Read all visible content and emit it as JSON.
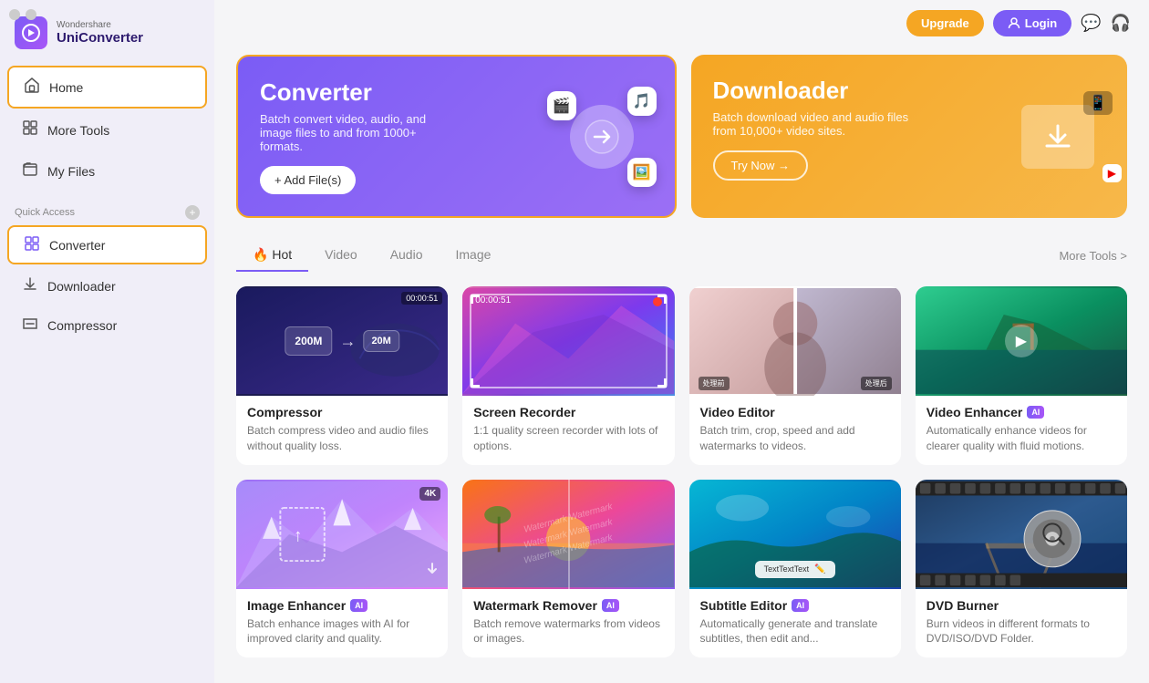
{
  "app": {
    "brand": "Wondershare",
    "name": "UniConverter",
    "traffic_light_close": "●",
    "traffic_light_min": "●"
  },
  "topbar": {
    "upgrade_label": "Upgrade",
    "login_label": "Login"
  },
  "sidebar": {
    "home_label": "Home",
    "more_tools_label": "More Tools",
    "my_files_label": "My Files",
    "quick_access_label": "Quick Access",
    "quick_items": [
      {
        "id": "converter",
        "label": "Converter",
        "active": true
      },
      {
        "id": "downloader",
        "label": "Downloader"
      },
      {
        "id": "compressor",
        "label": "Compressor"
      }
    ]
  },
  "hero": {
    "converter": {
      "title": "Converter",
      "subtitle": "Batch convert video, audio, and image files to and from 1000+ formats.",
      "btn_label": "+ Add File(s)"
    },
    "downloader": {
      "title": "Downloader",
      "subtitle": "Batch download video and audio files from 10,000+ video sites.",
      "btn_label": "Try Now →"
    }
  },
  "tabs": {
    "items": [
      {
        "id": "hot",
        "label": "Hot",
        "active": true,
        "fire": true
      },
      {
        "id": "video",
        "label": "Video"
      },
      {
        "id": "audio",
        "label": "Audio"
      },
      {
        "id": "image",
        "label": "Image"
      }
    ],
    "more_tools": "More Tools >"
  },
  "tools": [
    {
      "id": "compressor",
      "title": "Compressor",
      "desc": "Batch compress video and audio files without quality loss.",
      "ai": false,
      "compress_from": "200M",
      "compress_to": "20M"
    },
    {
      "id": "screen-recorder",
      "title": "Screen Recorder",
      "desc": "1:1 quality screen recorder with lots of options.",
      "ai": false
    },
    {
      "id": "video-editor",
      "title": "Video Editor",
      "desc": "Batch trim, crop, speed and add watermarks to videos.",
      "ai": false,
      "before_label": "处理前",
      "after_label": "处理后"
    },
    {
      "id": "video-enhancer",
      "title": "Video Enhancer",
      "desc": "Automatically enhance videos for clearer quality with fluid motions.",
      "ai": true
    },
    {
      "id": "image-enhancer",
      "title": "Image Enhancer",
      "desc": "Batch enhance images with AI for improved clarity and quality.",
      "ai": true,
      "fourk": "4K"
    },
    {
      "id": "watermark-remover",
      "title": "Watermark Remover",
      "desc": "Batch remove watermarks from videos or images.",
      "ai": true,
      "watermark_text": "Watermark"
    },
    {
      "id": "subtitle-editor",
      "title": "Subtitle Editor",
      "desc": "Automatically generate and translate subtitles, then edit and...",
      "ai": true,
      "subtitle_sample": "TextTextText"
    },
    {
      "id": "dvd-burner",
      "title": "DVD Burner",
      "desc": "Burn videos in different formats to DVD/ISO/DVD Folder.",
      "ai": false
    }
  ]
}
